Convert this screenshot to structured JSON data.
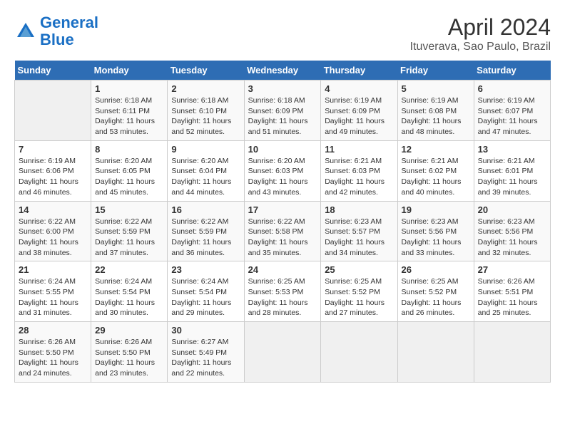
{
  "header": {
    "logo_line1": "General",
    "logo_line2": "Blue",
    "month_title": "April 2024",
    "location": "Ituverava, Sao Paulo, Brazil"
  },
  "calendar": {
    "days_of_week": [
      "Sunday",
      "Monday",
      "Tuesday",
      "Wednesday",
      "Thursday",
      "Friday",
      "Saturday"
    ],
    "weeks": [
      [
        {
          "day": "",
          "info": ""
        },
        {
          "day": "1",
          "info": "Sunrise: 6:18 AM\nSunset: 6:11 PM\nDaylight: 11 hours\nand 53 minutes."
        },
        {
          "day": "2",
          "info": "Sunrise: 6:18 AM\nSunset: 6:10 PM\nDaylight: 11 hours\nand 52 minutes."
        },
        {
          "day": "3",
          "info": "Sunrise: 6:18 AM\nSunset: 6:09 PM\nDaylight: 11 hours\nand 51 minutes."
        },
        {
          "day": "4",
          "info": "Sunrise: 6:19 AM\nSunset: 6:09 PM\nDaylight: 11 hours\nand 49 minutes."
        },
        {
          "day": "5",
          "info": "Sunrise: 6:19 AM\nSunset: 6:08 PM\nDaylight: 11 hours\nand 48 minutes."
        },
        {
          "day": "6",
          "info": "Sunrise: 6:19 AM\nSunset: 6:07 PM\nDaylight: 11 hours\nand 47 minutes."
        }
      ],
      [
        {
          "day": "7",
          "info": "Sunrise: 6:19 AM\nSunset: 6:06 PM\nDaylight: 11 hours\nand 46 minutes."
        },
        {
          "day": "8",
          "info": "Sunrise: 6:20 AM\nSunset: 6:05 PM\nDaylight: 11 hours\nand 45 minutes."
        },
        {
          "day": "9",
          "info": "Sunrise: 6:20 AM\nSunset: 6:04 PM\nDaylight: 11 hours\nand 44 minutes."
        },
        {
          "day": "10",
          "info": "Sunrise: 6:20 AM\nSunset: 6:03 PM\nDaylight: 11 hours\nand 43 minutes."
        },
        {
          "day": "11",
          "info": "Sunrise: 6:21 AM\nSunset: 6:03 PM\nDaylight: 11 hours\nand 42 minutes."
        },
        {
          "day": "12",
          "info": "Sunrise: 6:21 AM\nSunset: 6:02 PM\nDaylight: 11 hours\nand 40 minutes."
        },
        {
          "day": "13",
          "info": "Sunrise: 6:21 AM\nSunset: 6:01 PM\nDaylight: 11 hours\nand 39 minutes."
        }
      ],
      [
        {
          "day": "14",
          "info": "Sunrise: 6:22 AM\nSunset: 6:00 PM\nDaylight: 11 hours\nand 38 minutes."
        },
        {
          "day": "15",
          "info": "Sunrise: 6:22 AM\nSunset: 5:59 PM\nDaylight: 11 hours\nand 37 minutes."
        },
        {
          "day": "16",
          "info": "Sunrise: 6:22 AM\nSunset: 5:59 PM\nDaylight: 11 hours\nand 36 minutes."
        },
        {
          "day": "17",
          "info": "Sunrise: 6:22 AM\nSunset: 5:58 PM\nDaylight: 11 hours\nand 35 minutes."
        },
        {
          "day": "18",
          "info": "Sunrise: 6:23 AM\nSunset: 5:57 PM\nDaylight: 11 hours\nand 34 minutes."
        },
        {
          "day": "19",
          "info": "Sunrise: 6:23 AM\nSunset: 5:56 PM\nDaylight: 11 hours\nand 33 minutes."
        },
        {
          "day": "20",
          "info": "Sunrise: 6:23 AM\nSunset: 5:56 PM\nDaylight: 11 hours\nand 32 minutes."
        }
      ],
      [
        {
          "day": "21",
          "info": "Sunrise: 6:24 AM\nSunset: 5:55 PM\nDaylight: 11 hours\nand 31 minutes."
        },
        {
          "day": "22",
          "info": "Sunrise: 6:24 AM\nSunset: 5:54 PM\nDaylight: 11 hours\nand 30 minutes."
        },
        {
          "day": "23",
          "info": "Sunrise: 6:24 AM\nSunset: 5:54 PM\nDaylight: 11 hours\nand 29 minutes."
        },
        {
          "day": "24",
          "info": "Sunrise: 6:25 AM\nSunset: 5:53 PM\nDaylight: 11 hours\nand 28 minutes."
        },
        {
          "day": "25",
          "info": "Sunrise: 6:25 AM\nSunset: 5:52 PM\nDaylight: 11 hours\nand 27 minutes."
        },
        {
          "day": "26",
          "info": "Sunrise: 6:25 AM\nSunset: 5:52 PM\nDaylight: 11 hours\nand 26 minutes."
        },
        {
          "day": "27",
          "info": "Sunrise: 6:26 AM\nSunset: 5:51 PM\nDaylight: 11 hours\nand 25 minutes."
        }
      ],
      [
        {
          "day": "28",
          "info": "Sunrise: 6:26 AM\nSunset: 5:50 PM\nDaylight: 11 hours\nand 24 minutes."
        },
        {
          "day": "29",
          "info": "Sunrise: 6:26 AM\nSunset: 5:50 PM\nDaylight: 11 hours\nand 23 minutes."
        },
        {
          "day": "30",
          "info": "Sunrise: 6:27 AM\nSunset: 5:49 PM\nDaylight: 11 hours\nand 22 minutes."
        },
        {
          "day": "",
          "info": ""
        },
        {
          "day": "",
          "info": ""
        },
        {
          "day": "",
          "info": ""
        },
        {
          "day": "",
          "info": ""
        }
      ]
    ]
  }
}
